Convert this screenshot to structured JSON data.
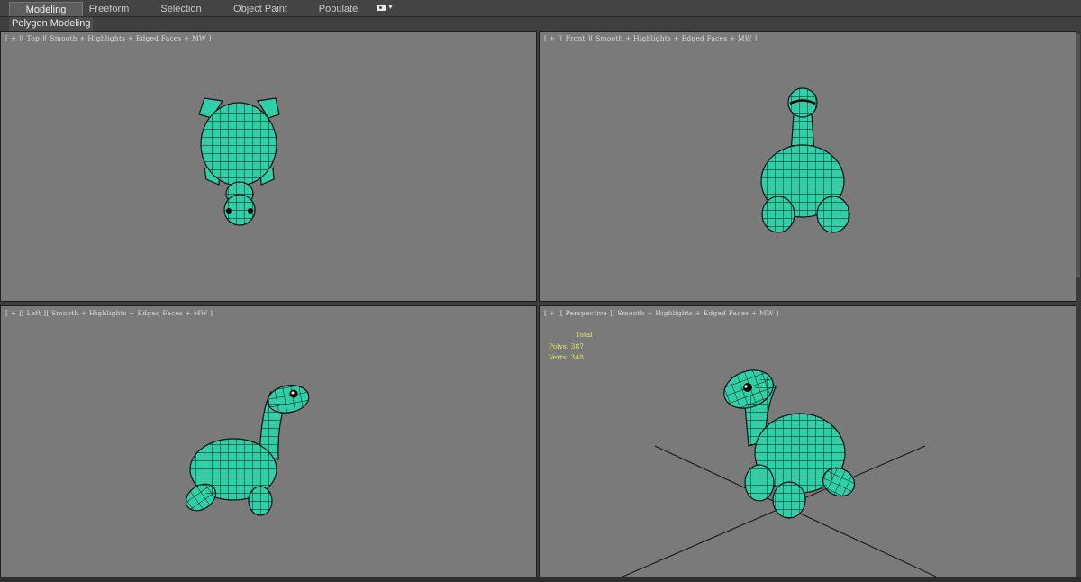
{
  "ribbon": {
    "tabs": [
      {
        "label": "Modeling",
        "active": true
      },
      {
        "label": "Freeform",
        "active": false
      },
      {
        "label": "Selection",
        "active": false
      },
      {
        "label": "Object Paint",
        "active": false
      },
      {
        "label": "Populate",
        "active": false
      }
    ],
    "menu_icon": "camera-icon"
  },
  "subbar": {
    "label": "Polygon Modeling"
  },
  "viewports": {
    "top": {
      "label": "[ + ][ Top ][ Smooth + Highlights + Edged Faces + MW ]"
    },
    "front": {
      "label": "[ + ][ Front ][ Smooth + Highlights + Edged Faces + MW ]"
    },
    "left": {
      "label": "[ + ][ Left ][ Smooth + Highlights + Edged Faces + MW ]"
    },
    "perspective": {
      "label": "[ + ][ Perspective ][ Smooth + Highlights + Edged Faces + MW ]",
      "stats": {
        "header": "Total",
        "polys_label": "Polys:",
        "polys": "387",
        "verts_label": "Verts:",
        "verts": "348"
      }
    }
  },
  "colors": {
    "model": "#2fd0a8",
    "edge": "#111111",
    "viewport_bg": "#7a7a7a",
    "stats_text": "#e8e85a"
  }
}
